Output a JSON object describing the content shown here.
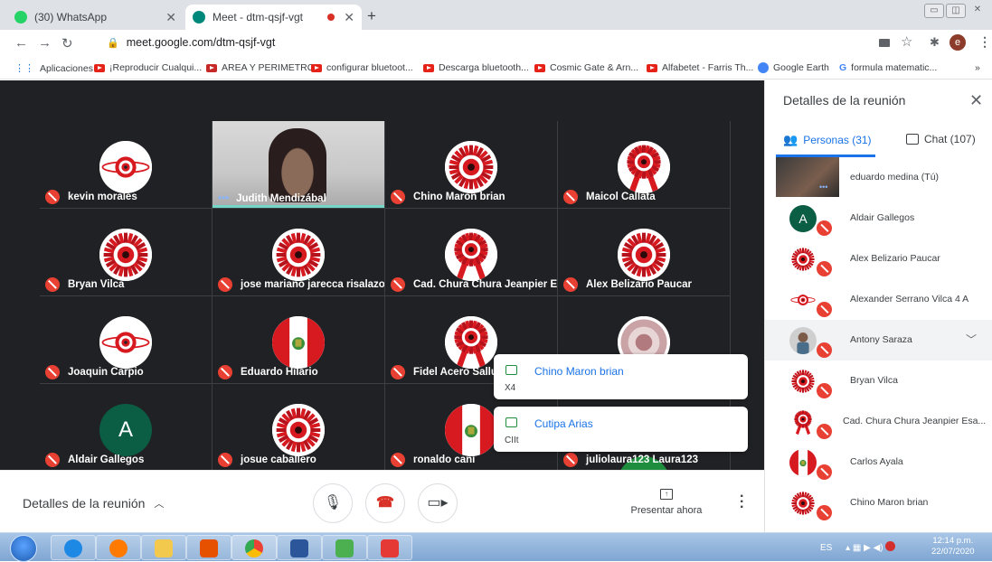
{
  "browser": {
    "tabs": [
      {
        "label": "(30) WhatsApp",
        "icon": "whatsapp-icon",
        "active": false
      },
      {
        "label": "Meet - dtm-qsjf-vgt",
        "icon": "meet-icon",
        "active": true
      }
    ],
    "new_tab": "+",
    "url": "meet.google.com/dtm-qsjf-vgt",
    "profile_initial": "e",
    "bookmarks": [
      "Aplicaciones",
      "¡Reproducir Cualqui...",
      "AREA Y PERIMETRO",
      "configurar bluetoot...",
      "Descarga bluetooth...",
      "Cosmic Gate & Arn...",
      "Alfabetet - Farris Th...",
      "Google Earth",
      "formula matematic..."
    ],
    "bookmarks_more": "»"
  },
  "meet": {
    "tiles": [
      {
        "name": "kevin morales",
        "avatar": "rosette-small"
      },
      {
        "name": "Judith Mendizábal",
        "avatar": "video"
      },
      {
        "name": "Chino Maron brian",
        "avatar": "rosette"
      },
      {
        "name": "Maicol Callata",
        "avatar": "rosette-ribbon"
      },
      {
        "name": "Bryan Vilca",
        "avatar": "rosette"
      },
      {
        "name": "jose mariano jarecca risalazo",
        "avatar": "rosette"
      },
      {
        "name": "Cad. Chura Chura Jeanpier Es...",
        "avatar": "rosette-ribbon"
      },
      {
        "name": "Alex Belizario Paucar",
        "avatar": "rosette"
      },
      {
        "name": "Joaquin Carpio",
        "avatar": "rosette-small"
      },
      {
        "name": "Eduardo Hilario",
        "avatar": "flag"
      },
      {
        "name": "Fidel Acero Sallu",
        "avatar": "rosette-ribbon"
      },
      {
        "name": "",
        "avatar": "rosette-pale"
      },
      {
        "name": "Aldair Gallegos",
        "avatar": "letter",
        "letter": "A"
      },
      {
        "name": "josue caballero",
        "avatar": "rosette"
      },
      {
        "name": "ronaldo cani",
        "avatar": "flag"
      },
      {
        "name": "juliolaura123 Laura123",
        "avatar": "none"
      }
    ],
    "toasts": [
      {
        "sender": "Chino Maron brian",
        "message": "X4"
      },
      {
        "sender": "Cutipa Arias",
        "message": "CIIt"
      }
    ]
  },
  "controls": {
    "details_label": "Detalles de la reunión",
    "present_label": "Presentar ahora"
  },
  "panel": {
    "title": "Detalles de la reunión",
    "people_tab": "Personas (31)",
    "chat_tab": "Chat (107)",
    "participants": [
      {
        "name": "eduardo medina (Tú)",
        "avatar": "video"
      },
      {
        "name": "Aldair Gallegos",
        "avatar": "letter",
        "letter": "A"
      },
      {
        "name": "Alex Belizario Paucar",
        "avatar": "rosette"
      },
      {
        "name": "Alexander Serrano Vilca 4 A",
        "avatar": "rosette-small"
      },
      {
        "name": "Antony Saraza",
        "avatar": "photo"
      },
      {
        "name": "Bryan Vilca",
        "avatar": "rosette"
      },
      {
        "name": "Cad. Chura Chura Jeanpier Esa...",
        "avatar": "rosette-ribbon"
      },
      {
        "name": "Carlos Ayala",
        "avatar": "flag"
      },
      {
        "name": "Chino Maron brian",
        "avatar": "rosette"
      }
    ]
  },
  "taskbar": {
    "lang": "ES",
    "time": "12:14 p.m.",
    "date": "22/07/2020"
  },
  "colors": {
    "meet_bg": "#202124",
    "accent_blue": "#1a73e8",
    "mic_off_red": "#e84032",
    "cockade_red": "#d71920"
  }
}
